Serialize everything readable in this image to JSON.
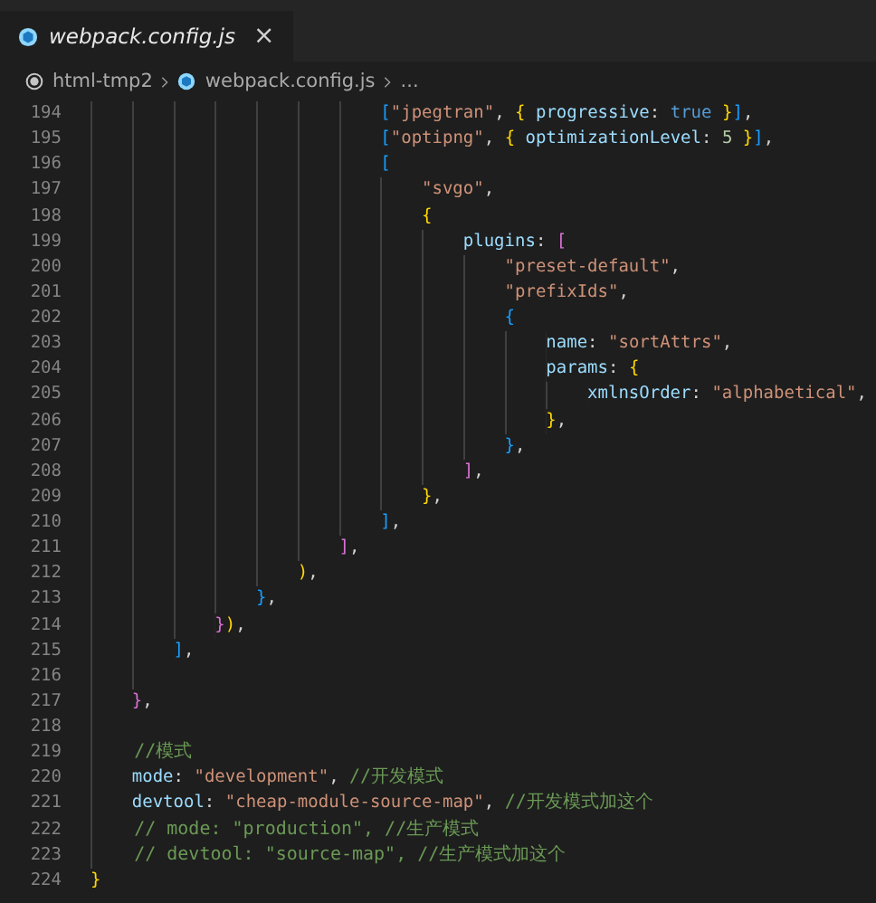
{
  "tab": {
    "title": "webpack.config.js",
    "preview": true,
    "close": "×"
  },
  "breadcrumb": [
    "html-tmp2",
    "webpack.config.js",
    "..."
  ],
  "lines": [
    {
      "number": "194",
      "tokens": [
        {
          "kind": "b3",
          "text": "                            ["
        },
        {
          "kind": "str",
          "text": "\"jpegtran\""
        },
        {
          "kind": "p",
          "text": ", "
        },
        {
          "kind": "b1",
          "text": "{"
        },
        {
          "kind": "key",
          "text": " progressive"
        },
        {
          "kind": "p",
          "text": ": "
        },
        {
          "kind": "kw",
          "text": "true"
        },
        {
          "kind": "b1",
          "text": " }"
        },
        {
          "kind": "b3",
          "text": "]"
        },
        {
          "kind": "p",
          "text": ","
        }
      ]
    },
    {
      "number": "195",
      "tokens": [
        {
          "kind": "b3",
          "text": "                            ["
        },
        {
          "kind": "str",
          "text": "\"optipng\""
        },
        {
          "kind": "p",
          "text": ", "
        },
        {
          "kind": "b1",
          "text": "{"
        },
        {
          "kind": "key",
          "text": " optimizationLevel"
        },
        {
          "kind": "p",
          "text": ": "
        },
        {
          "kind": "num",
          "text": "5"
        },
        {
          "kind": "b1",
          "text": " }"
        },
        {
          "kind": "b3",
          "text": "]"
        },
        {
          "kind": "p",
          "text": ","
        }
      ]
    },
    {
      "number": "196",
      "tokens": [
        {
          "kind": "b3",
          "text": "                            ["
        }
      ]
    },
    {
      "number": "197",
      "tokens": [
        {
          "kind": "str",
          "text": "                                \"svgo\""
        },
        {
          "kind": "p",
          "text": ","
        }
      ]
    },
    {
      "number": "198",
      "tokens": [
        {
          "kind": "b1",
          "text": "                                {"
        }
      ]
    },
    {
      "number": "199",
      "tokens": [
        {
          "kind": "key",
          "text": "                                    plugins"
        },
        {
          "kind": "p",
          "text": ": "
        },
        {
          "kind": "b2",
          "text": "["
        }
      ]
    },
    {
      "number": "200",
      "tokens": [
        {
          "kind": "str",
          "text": "                                        \"preset-default\""
        },
        {
          "kind": "p",
          "text": ","
        }
      ]
    },
    {
      "number": "201",
      "tokens": [
        {
          "kind": "str",
          "text": "                                        \"prefixIds\""
        },
        {
          "kind": "p",
          "text": ","
        }
      ]
    },
    {
      "number": "202",
      "tokens": [
        {
          "kind": "b3",
          "text": "                                        {"
        }
      ]
    },
    {
      "number": "203",
      "tokens": [
        {
          "kind": "key",
          "text": "                                            name"
        },
        {
          "kind": "p",
          "text": ": "
        },
        {
          "kind": "str",
          "text": "\"sortAttrs\""
        },
        {
          "kind": "p",
          "text": ","
        }
      ]
    },
    {
      "number": "204",
      "tokens": [
        {
          "kind": "key",
          "text": "                                            params"
        },
        {
          "kind": "p",
          "text": ": "
        },
        {
          "kind": "b1",
          "text": "{"
        }
      ]
    },
    {
      "number": "205",
      "tokens": [
        {
          "kind": "key",
          "text": "                                                xmlnsOrder"
        },
        {
          "kind": "p",
          "text": ": "
        },
        {
          "kind": "str",
          "text": "\"alphabetical\""
        },
        {
          "kind": "p",
          "text": ","
        }
      ]
    },
    {
      "number": "206",
      "tokens": [
        {
          "kind": "b1",
          "text": "                                            }"
        },
        {
          "kind": "p",
          "text": ","
        }
      ]
    },
    {
      "number": "207",
      "tokens": [
        {
          "kind": "b3",
          "text": "                                        }"
        },
        {
          "kind": "p",
          "text": ","
        }
      ]
    },
    {
      "number": "208",
      "tokens": [
        {
          "kind": "b2",
          "text": "                                    ]"
        },
        {
          "kind": "p",
          "text": ","
        }
      ]
    },
    {
      "number": "209",
      "tokens": [
        {
          "kind": "b1",
          "text": "                                }"
        },
        {
          "kind": "p",
          "text": ","
        }
      ]
    },
    {
      "number": "210",
      "tokens": [
        {
          "kind": "b3",
          "text": "                            ]"
        },
        {
          "kind": "p",
          "text": ","
        }
      ]
    },
    {
      "number": "211",
      "tokens": [
        {
          "kind": "b2",
          "text": "                        ]"
        },
        {
          "kind": "p",
          "text": ","
        }
      ]
    },
    {
      "number": "212",
      "tokens": [
        {
          "kind": "b1",
          "text": "                    )"
        },
        {
          "kind": "p",
          "text": ","
        }
      ]
    },
    {
      "number": "213",
      "tokens": [
        {
          "kind": "b3",
          "text": "                }"
        },
        {
          "kind": "p",
          "text": ","
        }
      ]
    },
    {
      "number": "214",
      "tokens": [
        {
          "kind": "b2",
          "text": "            }"
        },
        {
          "kind": "b1",
          "text": ")"
        },
        {
          "kind": "p",
          "text": ","
        }
      ]
    },
    {
      "number": "215",
      "tokens": [
        {
          "kind": "b3",
          "text": "        ]"
        },
        {
          "kind": "p",
          "text": ","
        }
      ]
    },
    {
      "number": "216"
    },
    {
      "number": "217",
      "tokens": [
        {
          "kind": "b2",
          "text": "    }"
        },
        {
          "kind": "p",
          "text": ","
        }
      ]
    },
    {
      "number": "218"
    },
    {
      "number": "219",
      "tokens": [
        {
          "kind": "com",
          "text": "    //模式"
        }
      ]
    },
    {
      "number": "220",
      "tokens": [
        {
          "kind": "key",
          "text": "    mode"
        },
        {
          "kind": "p",
          "text": ": "
        },
        {
          "kind": "str",
          "text": "\"development\""
        },
        {
          "kind": "p",
          "text": ", "
        },
        {
          "kind": "com",
          "text": "//开发模式"
        }
      ]
    },
    {
      "number": "221",
      "tokens": [
        {
          "kind": "key",
          "text": "    devtool"
        },
        {
          "kind": "p",
          "text": ": "
        },
        {
          "kind": "str",
          "text": "\"cheap-module-source-map\""
        },
        {
          "kind": "p",
          "text": ", "
        },
        {
          "kind": "com",
          "text": "//开发模式加这个"
        }
      ]
    },
    {
      "number": "222",
      "tokens": [
        {
          "kind": "com",
          "text": "    // mode: \"production\", //生产模式"
        }
      ]
    },
    {
      "number": "223",
      "tokens": [
        {
          "kind": "com",
          "text": "    // devtool: \"source-map\", //生产模式加这个"
        }
      ]
    },
    {
      "number": "224",
      "tokens": [
        {
          "kind": "b1",
          "text": "}"
        }
      ]
    }
  ]
}
